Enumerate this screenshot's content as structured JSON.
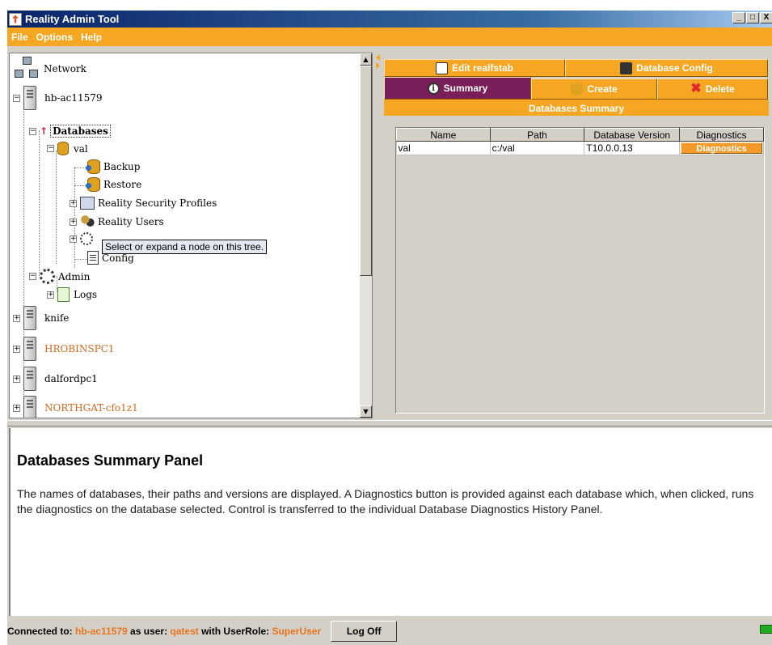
{
  "window": {
    "title": "Reality Admin Tool",
    "controls": [
      "_",
      "□",
      "X"
    ]
  },
  "menu": [
    "File",
    "Options",
    "Help"
  ],
  "tree": {
    "network": "Network",
    "host": "hb-ac11579",
    "databases": "Databases",
    "db_val": "val",
    "backup": "Backup",
    "restore": "Restore",
    "security_profiles": "Reality Security Profiles",
    "reality_users": "Reality Users",
    "config": "Config",
    "admin": "Admin",
    "logs": "Logs",
    "other_hosts": [
      {
        "name": "knife",
        "highlight": false
      },
      {
        "name": "HROBINSPC1",
        "highlight": true
      },
      {
        "name": "dalfordpc1",
        "highlight": false
      },
      {
        "name": "NORTHGAT-cfo1z1",
        "highlight": true
      }
    ],
    "tooltip": "Select or expand a node on this tree."
  },
  "tabs": {
    "edit_realfstab": "Edit realfstab",
    "database_config": "Database Config",
    "summary": "Summary",
    "create": "Create",
    "delete": "Delete"
  },
  "summary": {
    "header": "Databases Summary",
    "columns": [
      "Name",
      "Path",
      "Database Version",
      "Diagnostics"
    ],
    "rows": [
      {
        "name": "val",
        "path": "c:/val",
        "version": "T10.0.0.13",
        "diagnostics": "Diagnostics"
      }
    ]
  },
  "help": {
    "title": "Databases Summary Panel",
    "body": "The names of databases, their paths and versions are displayed. A Diagnostics button is provided against each database which, when clicked, runs the diagnostics on the database selected. Control is transferred to the individual Database Diagnostics History Panel."
  },
  "status": {
    "connected_to_label": "Connected to: ",
    "host": "hb-ac11579",
    "as_user_label": " as user: ",
    "user": "qatest",
    "role_label": " with UserRole: ",
    "role": "SuperUser",
    "logoff": "Log Off"
  },
  "colors": {
    "accent": "#f5a623",
    "active_tab": "#7a1e5a",
    "highlight_text": "#d1691d"
  }
}
